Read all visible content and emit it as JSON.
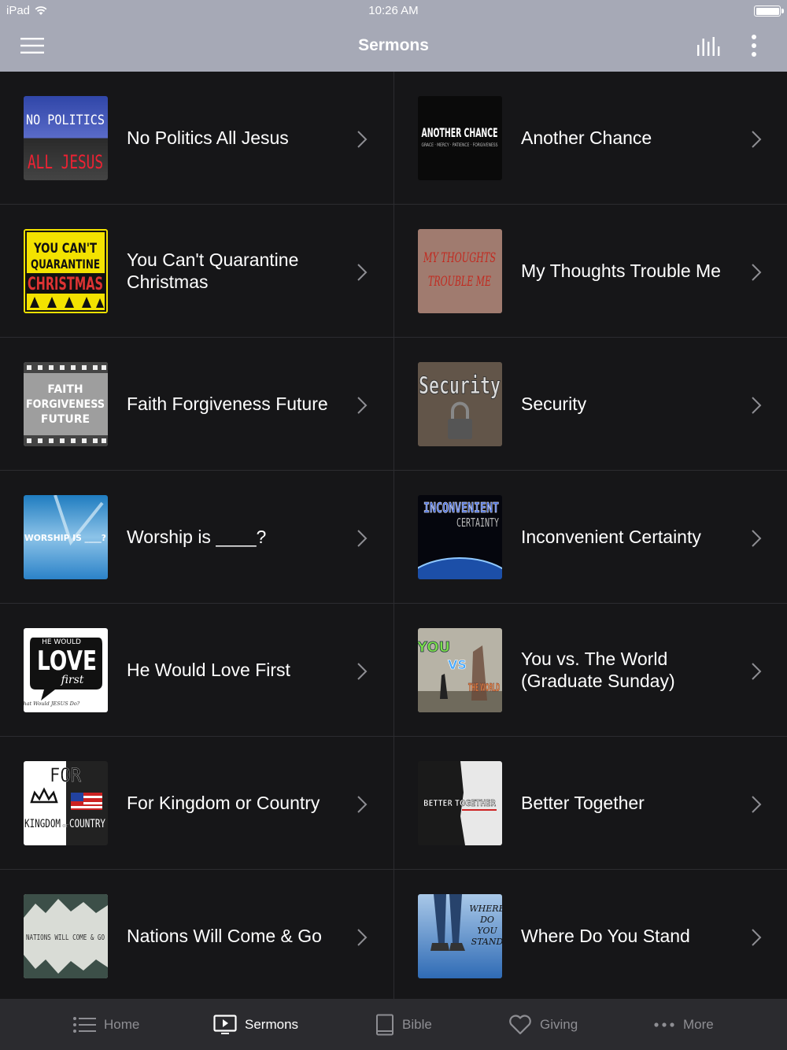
{
  "status_bar": {
    "carrier": "iPad",
    "time": "10:26 AM"
  },
  "header": {
    "title": "Sermons"
  },
  "sermons": [
    {
      "title": "No Politics All Jesus",
      "art": [
        "NO POLITICS",
        "ALL JESUS"
      ]
    },
    {
      "title": "Another Chance",
      "art": [
        "ANOTHER CHANCE",
        "GRACE · MERCY · PATIENCE · FORGIVENESS"
      ]
    },
    {
      "title": "You Can't Quarantine Christmas",
      "art": [
        "YOU CAN'T",
        "QUARANTINE",
        "CHRISTMAS"
      ]
    },
    {
      "title": "My Thoughts Trouble Me",
      "art": [
        "MY THOUGHTS",
        "TROUBLE ME"
      ]
    },
    {
      "title": "Faith Forgiveness Future",
      "art": [
        "FAITH",
        "FORGIVENESS",
        "FUTURE"
      ]
    },
    {
      "title": "Security",
      "art": [
        "Security"
      ]
    },
    {
      "title": "Worship is ____?",
      "art": [
        "WORSHIP IS ____?"
      ]
    },
    {
      "title": "Inconvenient Certainty",
      "art": [
        "INCONVENIENT",
        "CERTAINTY"
      ]
    },
    {
      "title": "He Would Love First",
      "art": [
        "HE WOULD",
        "LOVE",
        "first",
        "What Would JESUS Do?"
      ]
    },
    {
      "title": "You vs. The World (Graduate Sunday)",
      "art": [
        "YOU",
        "VS",
        "THE WORLD"
      ]
    },
    {
      "title": "For Kingdom or Country",
      "art": [
        "FOR",
        "KINGDOM",
        "or",
        "COUNTRY"
      ]
    },
    {
      "title": "Better Together",
      "art": [
        "BETTER TOGETHER"
      ]
    },
    {
      "title": "Nations Will Come & Go",
      "art": [
        "NATIONS WILL COME & GO"
      ]
    },
    {
      "title": "Where Do You Stand",
      "art": [
        "WHERE",
        "DO",
        "YOU",
        "STAND"
      ]
    }
  ],
  "tabs": [
    {
      "label": "Home",
      "icon": "list-icon",
      "active": false
    },
    {
      "label": "Sermons",
      "icon": "play-screen-icon",
      "active": true
    },
    {
      "label": "Bible",
      "icon": "book-icon",
      "active": false
    },
    {
      "label": "Giving",
      "icon": "heart-icon",
      "active": false
    },
    {
      "label": "More",
      "icon": "ellipsis-icon",
      "active": false
    }
  ],
  "colors": {
    "nav_bar": "#a6a9b6",
    "background": "#161618",
    "tab_bar": "#2b2b2f",
    "tab_inactive": "#8e8e93",
    "tab_active": "#ffffff"
  }
}
